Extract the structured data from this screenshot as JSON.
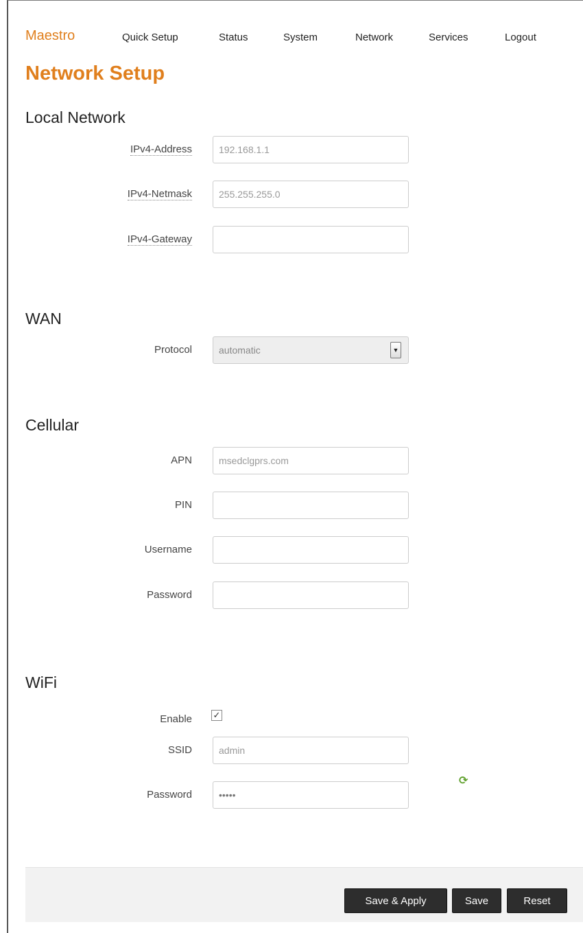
{
  "nav": {
    "brand": "Maestro",
    "items": [
      "Quick Setup",
      "Status",
      "System",
      "Network",
      "Services",
      "Logout"
    ]
  },
  "page_title": "Network Setup",
  "sections": {
    "local": {
      "title": "Local Network",
      "ipv4_address": {
        "label": "IPv4-Address",
        "placeholder": "192.168.1.1"
      },
      "ipv4_netmask": {
        "label": "IPv4-Netmask",
        "placeholder": "255.255.255.0"
      },
      "ipv4_gateway": {
        "label": "IPv4-Gateway",
        "placeholder": ""
      }
    },
    "wan": {
      "title": "WAN",
      "protocol": {
        "label": "Protocol",
        "value": "automatic"
      }
    },
    "cellular": {
      "title": "Cellular",
      "apn": {
        "label": "APN",
        "placeholder": "msedclgprs.com"
      },
      "pin": {
        "label": "PIN",
        "value": ""
      },
      "username": {
        "label": "Username",
        "value": ""
      },
      "password": {
        "label": "Password",
        "value": ""
      }
    },
    "wifi": {
      "title": "WiFi",
      "enable": {
        "label": "Enable",
        "checked": true
      },
      "ssid": {
        "label": "SSID",
        "placeholder": "admin"
      },
      "password": {
        "label": "Password",
        "value": "admin"
      }
    }
  },
  "actions": {
    "save_apply": "Save & Apply",
    "save": "Save",
    "reset": "Reset"
  },
  "colors": {
    "accent": "#e07f1d",
    "button": "#2d2d2d",
    "reveal_icon": "#5fa02c"
  },
  "icons": {
    "reveal_password": "refresh-icon",
    "select_arrow": "chevron-down-icon",
    "checkbox": "check-icon"
  }
}
